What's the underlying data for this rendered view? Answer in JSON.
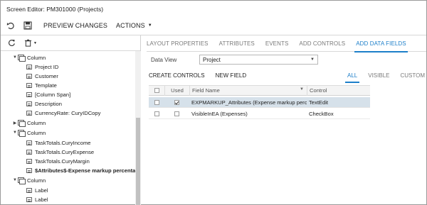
{
  "window": {
    "title": "Screen Editor: PM301000 (Projects)"
  },
  "toolbar": {
    "undo_icon": "undo-icon",
    "save_icon": "save-icon",
    "preview_label": "PREVIEW CHANGES",
    "actions_label": "ACTIONS"
  },
  "left_toolbar": {
    "refresh_icon": "refresh-icon",
    "delete_icon": "trash-icon"
  },
  "tree": [
    {
      "label": "Column",
      "type": "folder",
      "expanded": true
    },
    {
      "label": "Project ID",
      "type": "field"
    },
    {
      "label": "Customer",
      "type": "field"
    },
    {
      "label": "Template",
      "type": "field"
    },
    {
      "label": "[Column Span]",
      "type": "field"
    },
    {
      "label": "Description",
      "type": "field"
    },
    {
      "label": "CurrencyRate: CuryIDCopy",
      "type": "field"
    },
    {
      "label": "Column",
      "type": "folder",
      "expanded": false
    },
    {
      "label": "Column",
      "type": "folder",
      "expanded": true
    },
    {
      "label": "TaskTotals.CuryIncome",
      "type": "field"
    },
    {
      "label": "TaskTotals.CuryExpense",
      "type": "field"
    },
    {
      "label": "TaskTotals.CuryMargin",
      "type": "field"
    },
    {
      "label": "$Attributes$-Expense markup percentag",
      "type": "field",
      "bold": true
    },
    {
      "label": "Column",
      "type": "folder",
      "expanded": true
    },
    {
      "label": "Label",
      "type": "field"
    },
    {
      "label": "Label",
      "type": "field"
    }
  ],
  "tabs": [
    "LAYOUT PROPERTIES",
    "ATTRIBUTES",
    "EVENTS",
    "ADD CONTROLS",
    "ADD DATA FIELDS"
  ],
  "active_tab": "ADD DATA FIELDS",
  "data_view": {
    "label": "Data View",
    "value": "Project"
  },
  "actions": {
    "create_controls": "CREATE CONTROLS",
    "new_field": "NEW FIELD"
  },
  "filters": [
    "ALL",
    "VISIBLE",
    "CUSTOM"
  ],
  "active_filter": "ALL",
  "grid": {
    "headers": {
      "used": "Used",
      "field_name": "Field Name",
      "control": "Control"
    },
    "rows": [
      {
        "used": true,
        "field_name": "EXPMARKUP_Attributes (Expense markup percer",
        "control": "TextEdit",
        "selected": true
      },
      {
        "used": false,
        "field_name": "VisibleInEA (Expenses)",
        "control": "CheckBox",
        "selected": false
      }
    ]
  },
  "colors": {
    "accent": "#1d7fc9",
    "selected_row": "#d6e1ea"
  }
}
